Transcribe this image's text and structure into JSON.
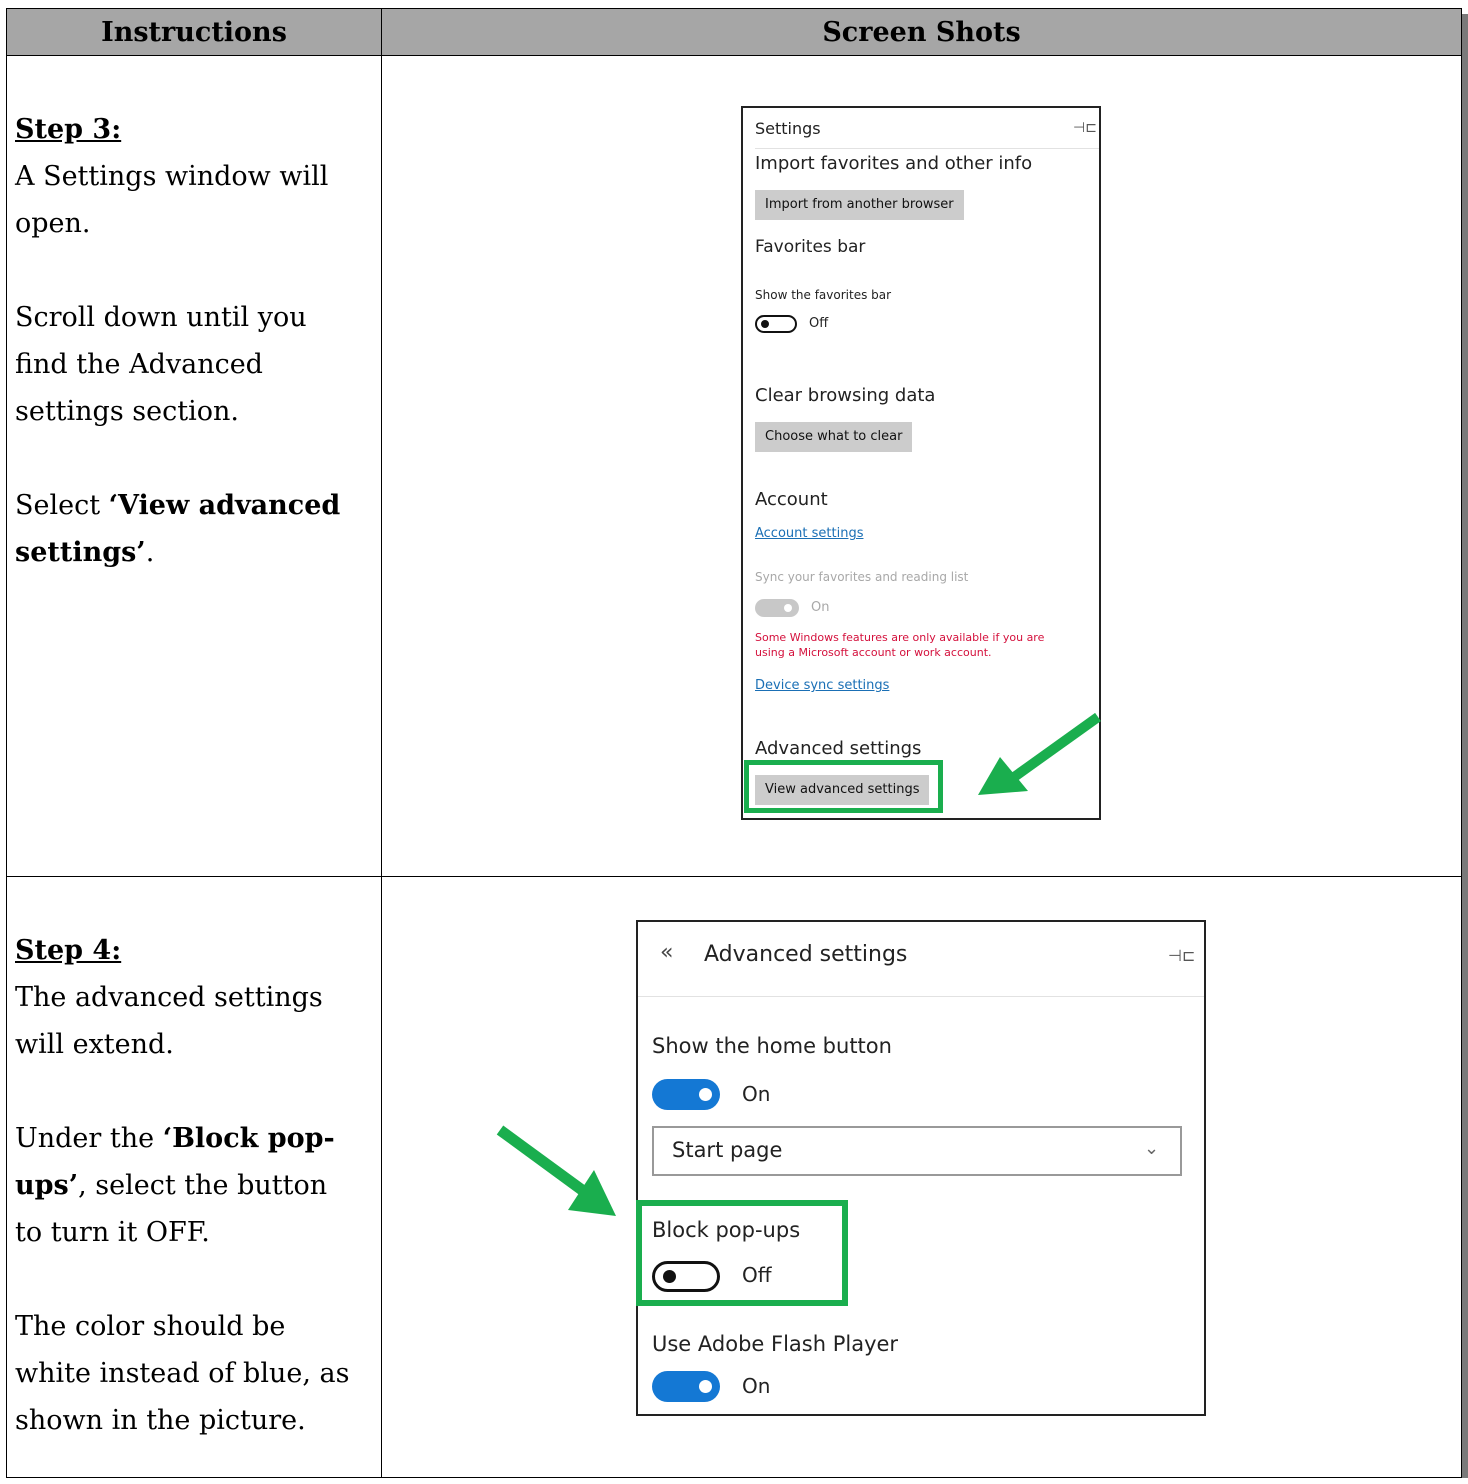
{
  "table": {
    "header_instructions": "Instructions",
    "header_screenshots": "Screen Shots"
  },
  "step3": {
    "title": "Step 3:",
    "line1": "A Settings window will open.",
    "line2": "Scroll down until you find the Advanced settings section.",
    "line3_prefix": "Select ",
    "line3_bold": "‘View advanced settings’",
    "line3_suffix": "."
  },
  "step4": {
    "title": "Step 4:",
    "line1": "The advanced settings will extend.",
    "line2_prefix": "Under the ",
    "line2_bold": "‘Block pop-ups’",
    "line2_suffix": ", select the button to turn it OFF.",
    "line3": "The color should be white instead of blue, as shown in the picture."
  },
  "settings_panel": {
    "title": "Settings",
    "import_heading": "Import favorites and other info",
    "import_button": "Import from another browser",
    "favorites_heading": "Favorites bar",
    "show_favorites_label": "Show the favorites bar",
    "show_favorites_state": "Off",
    "clear_heading": "Clear browsing data",
    "clear_button": "Choose what to clear",
    "account_heading": "Account",
    "account_link": "Account settings",
    "sync_label": "Sync your favorites and reading list",
    "sync_state": "On",
    "warning_text": "Some Windows features are only available if you are using a Microsoft account or work account.",
    "device_sync_link": "Device sync settings",
    "advanced_heading": "Advanced settings",
    "advanced_button": "View advanced settings"
  },
  "advanced_panel": {
    "back_glyph": "«",
    "title": "Advanced settings",
    "home_label": "Show the home button",
    "home_state": "On",
    "home_select": "Start page",
    "popups_label": "Block pop-ups",
    "popups_state": "Off",
    "flash_label": "Use Adobe Flash Player",
    "flash_state": "On"
  },
  "colors": {
    "highlight": "#1aae4e",
    "toggle_on": "#1478d4",
    "warning": "#d4103c",
    "link": "#1a6fb5",
    "header_bg": "#a6a6a6"
  }
}
